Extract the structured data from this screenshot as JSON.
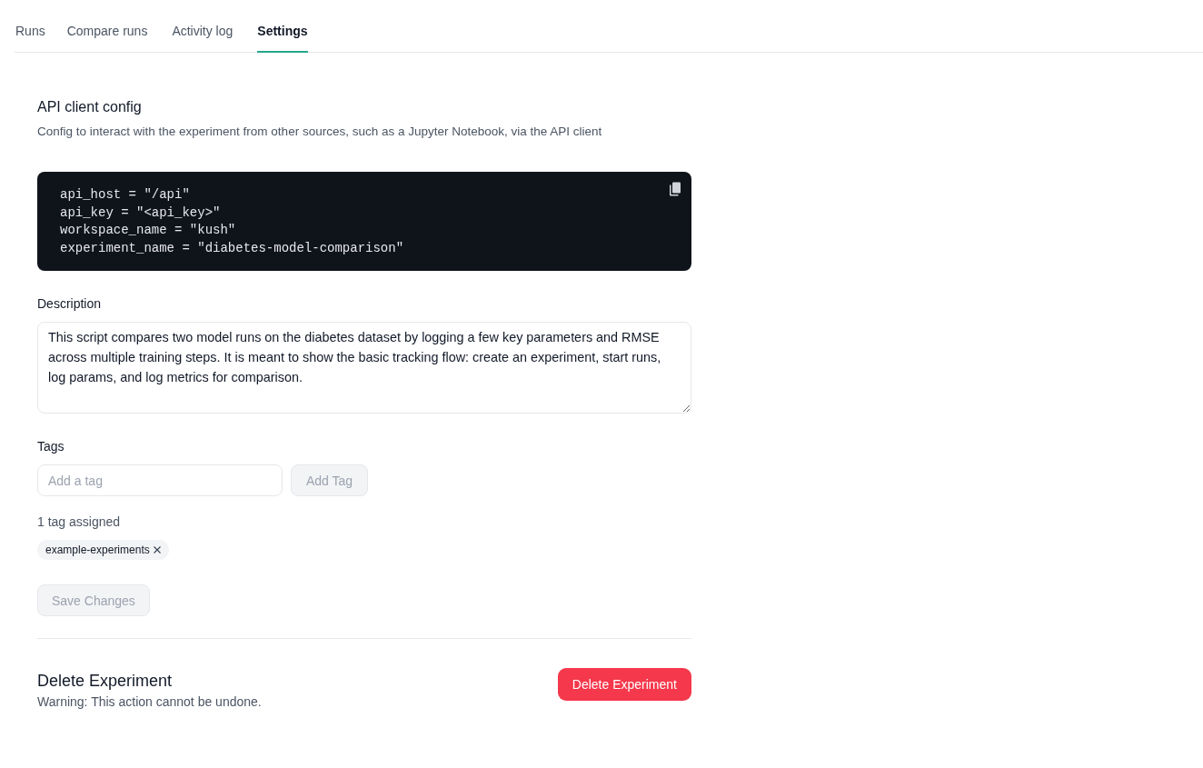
{
  "tabs": [
    {
      "label": "Runs",
      "selected": false
    },
    {
      "label": "Compare runs",
      "selected": false
    },
    {
      "label": "Activity log",
      "selected": false
    },
    {
      "label": "Settings",
      "selected": true
    }
  ],
  "api_config": {
    "title": "API client config",
    "description": "Config to interact with the experiment from other sources, such as a Jupyter Notebook, via the API client",
    "code_lines": [
      "api_host = \"/api\"",
      "api_key = \"<api_key>\"",
      "workspace_name = \"kush\"",
      "experiment_name = \"diabetes-model-comparison\""
    ]
  },
  "description": {
    "label": "Description",
    "value": "This script compares two model runs on the diabetes dataset by logging a few key parameters and RMSE across multiple training steps. It is meant to show the basic tracking flow: create an experiment, start runs, log params, and log metrics for comparison."
  },
  "tags": {
    "label": "Tags",
    "input": {
      "placeholder": "Add a tag"
    },
    "add_button": {
      "label": "Add Tag",
      "disabled": true
    },
    "count_text": "1 tag assigned",
    "items": [
      {
        "label": "example-experiments"
      }
    ]
  },
  "save_button": {
    "label": "Save Changes",
    "disabled": true
  },
  "danger_zone": {
    "title": "Delete Experiment",
    "warning": "Warning: This action cannot be undone.",
    "button": {
      "label": "Delete Experiment"
    }
  }
}
